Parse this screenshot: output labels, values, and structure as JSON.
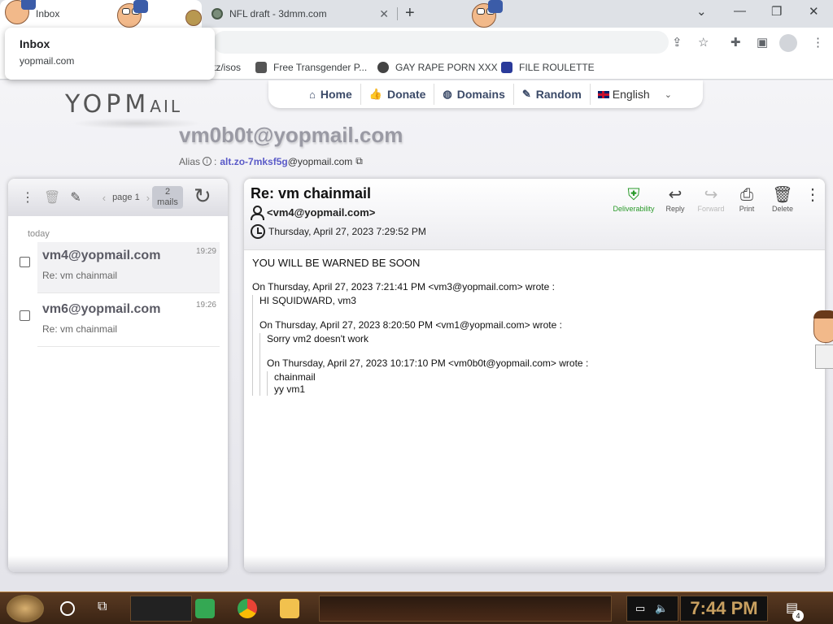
{
  "browser": {
    "tabs": [
      {
        "title": "Inbox",
        "active": true
      },
      {
        "title": "NFL draft - 3dmm.com",
        "active": false
      }
    ],
    "new_tab": "+",
    "tooltip": {
      "title": "Inbox",
      "url": "yopmail.com"
    },
    "bookmarks": [
      {
        "label": "tz/isos"
      },
      {
        "label": "Free Transgender P..."
      },
      {
        "label": "GAY RAPE PORN XXX"
      },
      {
        "label": "FILE ROULETTE"
      }
    ]
  },
  "site": {
    "logo_main": "YOPM",
    "logo_tail": "AIL",
    "nav": [
      {
        "label": "Home",
        "icon": "home-icon",
        "glyph": "⌂"
      },
      {
        "label": "Donate",
        "icon": "thumbs-up-icon",
        "glyph": "👍"
      },
      {
        "label": "Domains",
        "icon": "globe-icon",
        "glyph": "◍"
      },
      {
        "label": "Random",
        "icon": "magic-wand-icon",
        "glyph": "✎"
      }
    ],
    "language": "English",
    "address": "vm0b0t@yopmail.com",
    "alias_label": "Alias",
    "alias_value": "alt.zo-7mksf5g",
    "alias_domain": "@yopmail.com"
  },
  "inbox": {
    "page_label": "page 1",
    "count_num": "2",
    "count_label": "mails",
    "day_label": "today",
    "mails": [
      {
        "from": "vm4@yopmail.com",
        "subject": "Re: vm chainmail",
        "time": "19:29",
        "selected": true
      },
      {
        "from": "vm6@yopmail.com",
        "subject": "Re: vm chainmail",
        "time": "19:26",
        "selected": false
      }
    ]
  },
  "message": {
    "subject": "Re: vm chainmail",
    "from": "<vm4@yopmail.com>",
    "date": "Thursday, April 27, 2023 7:29:52 PM",
    "actions": {
      "deliverability": "Deliverability",
      "reply": "Reply",
      "forward": "Forward",
      "print": "Print",
      "delete": "Delete"
    },
    "body": {
      "lead": "YOU WILL BE WARNED BE SOON",
      "q1_header": "On Thursday, April 27, 2023 7:21:41 PM <vm3@yopmail.com> wrote :",
      "q1_text": "HI SQUIDWARD, vm3",
      "q2_header": "On Thursday, April 27, 2023 8:20:50 PM <vm1@yopmail.com> wrote :",
      "q2_text": "Sorry vm2 doesn't work",
      "q3_header": "On Thursday, April 27, 2023 10:17:10 PM <vm0b0t@yopmail.com> wrote :",
      "q3_line1": "chainmail",
      "q3_line2": "yy vm1"
    }
  },
  "taskbar": {
    "time": "7:44 PM",
    "notification_count": "4"
  },
  "colors": {
    "nav_text": "#3b4a68",
    "alias": "#5a5ac8",
    "deliverability": "#2a9a2a",
    "clock": "#c8a060"
  }
}
